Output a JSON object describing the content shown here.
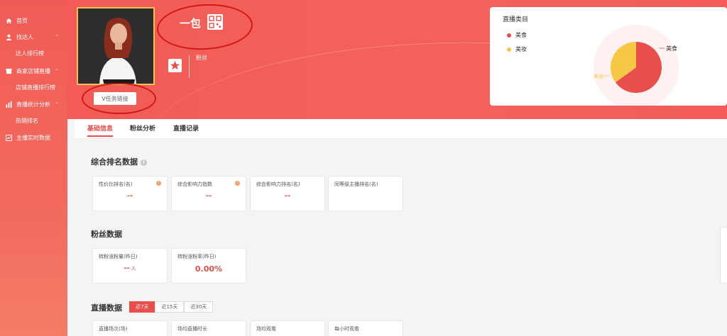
{
  "sidebar": {
    "items": [
      {
        "label": "首页",
        "icon": "home-icon"
      },
      {
        "label": "找达人",
        "icon": "user-icon"
      },
      {
        "label": "达人排行榜",
        "sub": true
      },
      {
        "label": "商家店铺直播",
        "icon": "shop-icon"
      },
      {
        "label": "店铺直播排行榜",
        "sub": true
      },
      {
        "label": "直播统计分析",
        "icon": "bar-chart-icon"
      },
      {
        "label": "热销排名",
        "sub": true
      },
      {
        "label": "主播实时数据",
        "icon": "realtime-data-icon"
      }
    ]
  },
  "profile": {
    "name": "一包",
    "task_button": "V任务链接",
    "fans_label": "粉丝"
  },
  "category_card": {
    "title": "直播类目",
    "legend": [
      {
        "label": "美食",
        "color": "#e84e4a"
      },
      {
        "label": "美妆",
        "color": "#f7c846"
      }
    ],
    "pie_labels": {
      "meishi": "美食",
      "meizhuang": "美妆"
    }
  },
  "chart_data": {
    "type": "pie",
    "title": "直播类目",
    "series": [
      {
        "name": "美食",
        "values": [
          65
        ]
      },
      {
        "name": "美妆",
        "values": [
          35
        ]
      }
    ],
    "categories": [
      "美食",
      "美妆"
    ],
    "values": [
      65,
      35
    ],
    "colors": [
      "#e84e4a",
      "#f7c846"
    ],
    "legend": "top-left"
  },
  "tabs": [
    {
      "label": "基础信息",
      "active": true
    },
    {
      "label": "粉丝分析",
      "active": false
    },
    {
      "label": "直播记录",
      "active": false
    }
  ],
  "ranking": {
    "title": "综合排名数据",
    "info": "i",
    "cards": [
      {
        "label": "性价比排名(名)",
        "value": "--"
      },
      {
        "label": "综合影响力指数",
        "value": "--"
      },
      {
        "label": "综合影响力排名(名)",
        "value": "--"
      },
      {
        "label": "同等级主播排名(名)",
        "value": ""
      }
    ]
  },
  "fans": {
    "title": "粉丝数据",
    "cards": [
      {
        "label": "转粉涨粉量(昨日)",
        "value": "--",
        "unit": "人"
      },
      {
        "label": "转粉涨粉率(昨日)",
        "value": "0.00%"
      }
    ]
  },
  "live": {
    "title": "直播数据",
    "ranges": [
      {
        "label": "近7天",
        "active": true
      },
      {
        "label": "近15天",
        "active": false
      },
      {
        "label": "近30天",
        "active": false
      }
    ],
    "cards": [
      {
        "label": "直播场次(场)"
      },
      {
        "label": "场均直播时长"
      },
      {
        "label": "场均观看"
      },
      {
        "label": "每小时观看"
      }
    ]
  }
}
